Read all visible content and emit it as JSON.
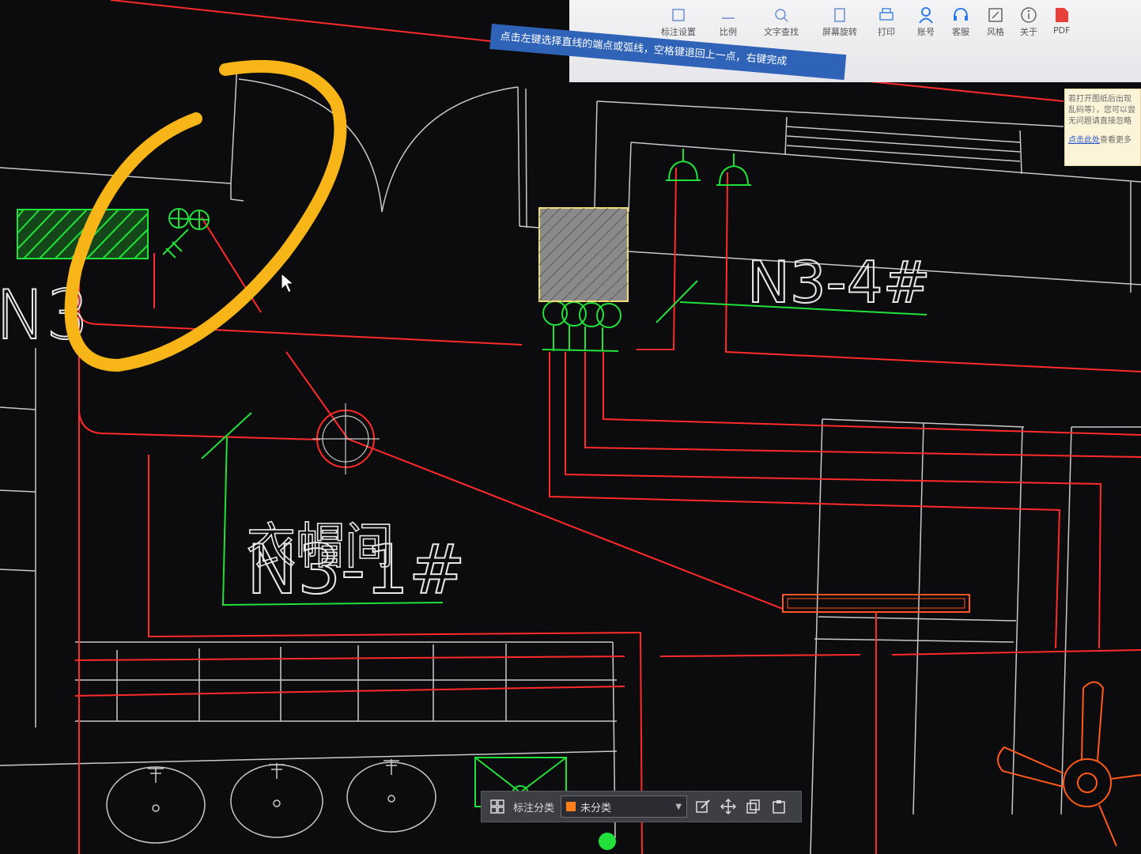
{
  "toolbar": {
    "items": [
      {
        "label": "标注设置",
        "icon": "annotation-settings-icon"
      },
      {
        "label": "比例",
        "icon": "scale-icon"
      },
      {
        "label": "文字查找",
        "icon": "text-search-icon"
      },
      {
        "label": "屏幕旋转",
        "icon": "screen-rotate-icon"
      },
      {
        "label": "打印",
        "icon": "printer-icon"
      },
      {
        "label": "账号",
        "icon": "account-icon"
      },
      {
        "label": "客服",
        "icon": "headset-icon"
      },
      {
        "label": "风格",
        "icon": "style-icon"
      },
      {
        "label": "关于",
        "icon": "info-icon"
      },
      {
        "label": "PDF",
        "icon": "pdf-icon"
      }
    ]
  },
  "command_prompt": "点击左键选择直线的端点或弧线，空格键退回上一点，右键完成",
  "notice": {
    "line1": "若打开图纸后出现",
    "line2": "乱码等），您可以尝",
    "line3": "无问题请直接忽略",
    "link": "点击此处",
    "link_suffix": "查看更多"
  },
  "drawing_labels": {
    "left_room_code": "N3",
    "room_1_code": "N3-1#",
    "room_1_name": "衣帽间",
    "room_4_code": "N3-4#"
  },
  "statusbar": {
    "label": "标注分类",
    "selected": "未分类"
  },
  "colors": {
    "background": "#0c0c0e",
    "wall_line": "#c9c9c9",
    "wire_red": "#ff2a2a",
    "device_green": "#22e03a",
    "highlight_yellow": "#f7b518",
    "fill_orange": "#ff7f1a"
  }
}
